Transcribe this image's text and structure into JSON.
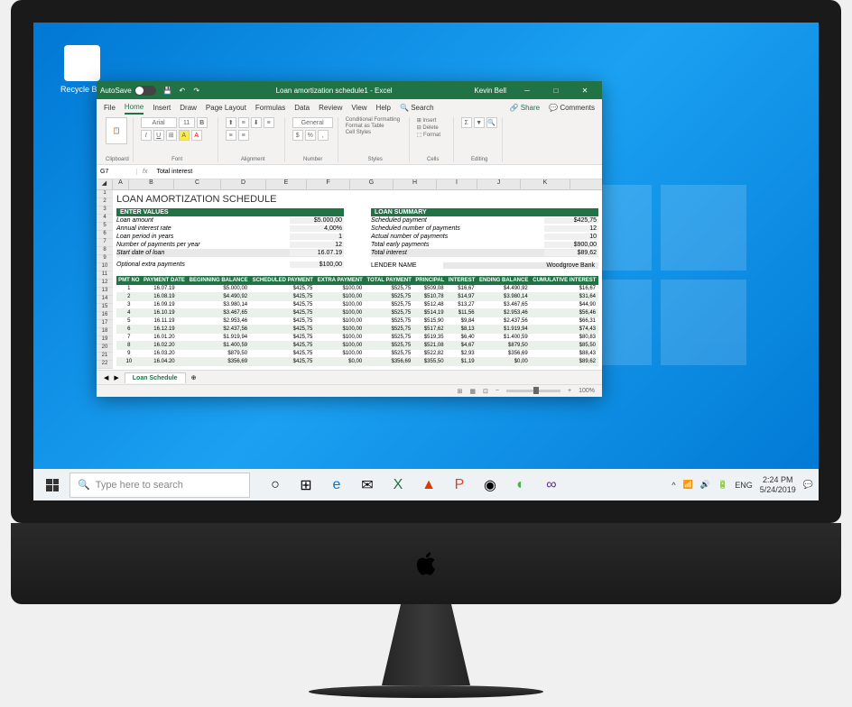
{
  "desktop": {
    "recycle_bin": "Recycle Bin"
  },
  "excel": {
    "autosave_label": "AutoSave",
    "title": "Loan amortization schedule1 - Excel",
    "user": "Kevin Bell",
    "tabs": {
      "file": "File",
      "home": "Home",
      "insert": "Insert",
      "draw": "Draw",
      "page_layout": "Page Layout",
      "formulas": "Formulas",
      "data": "Data",
      "review": "Review",
      "view": "View",
      "help": "Help",
      "search": "Search"
    },
    "share": "Share",
    "comments": "Comments",
    "ribbon": {
      "clipboard": "Clipboard",
      "paste": "Paste",
      "font_name": "Arial",
      "font_size": "11",
      "font": "Font",
      "alignment": "Alignment",
      "number_format": "General",
      "number": "Number",
      "cond_format": "Conditional Formatting",
      "format_table": "Format as Table",
      "cell_styles": "Cell Styles",
      "styles": "Styles",
      "insert_btn": "Insert",
      "delete_btn": "Delete",
      "format_btn": "Format",
      "cells": "Cells",
      "sort_filter": "Sort & Filter",
      "find_select": "Find & Select",
      "editing": "Editing"
    },
    "name_box": "G7",
    "formula": "Total interest",
    "columns": [
      "A",
      "B",
      "C",
      "D",
      "E",
      "F",
      "G",
      "H",
      "I",
      "J",
      "K"
    ],
    "doc": {
      "title": "LOAN AMORTIZATION SCHEDULE",
      "enter_values_header": "ENTER VALUES",
      "loan_summary_header": "LOAN SUMMARY",
      "enter_values": [
        {
          "label": "Loan amount",
          "value": "$5.000,00"
        },
        {
          "label": "Annual interest rate",
          "value": "4,00%"
        },
        {
          "label": "Loan period in years",
          "value": "1"
        },
        {
          "label": "Number of payments per year",
          "value": "12"
        },
        {
          "label": "Start date of loan",
          "value": "16.07.19"
        }
      ],
      "optional_extra": {
        "label": "Optional extra payments",
        "value": "$100,00"
      },
      "loan_summary": [
        {
          "label": "Scheduled payment",
          "value": "$425,75"
        },
        {
          "label": "Scheduled number of payments",
          "value": "12"
        },
        {
          "label": "Actual number of payments",
          "value": "10"
        },
        {
          "label": "Total early payments",
          "value": "$900,00"
        },
        {
          "label": "Total interest",
          "value": "$89,62"
        }
      ],
      "lender_label": "LENDER NAME",
      "lender_value": "Woodgrove Bank",
      "table_headers": [
        "PMT NO",
        "PAYMENT DATE",
        "BEGINNING BALANCE",
        "SCHEDULED PAYMENT",
        "EXTRA PAYMENT",
        "TOTAL PAYMENT",
        "PRINCIPAL",
        "INTEREST",
        "ENDING BALANCE",
        "CUMULATIVE INTEREST"
      ],
      "table_rows": [
        [
          "1",
          "16.07.19",
          "$5.000,00",
          "$425,75",
          "$100,00",
          "$525,75",
          "$509,08",
          "$16,67",
          "$4.490,92",
          "$16,67"
        ],
        [
          "2",
          "16.08.19",
          "$4.490,92",
          "$425,75",
          "$100,00",
          "$525,75",
          "$510,78",
          "$14,97",
          "$3.980,14",
          "$31,64"
        ],
        [
          "3",
          "16.09.19",
          "$3.980,14",
          "$425,75",
          "$100,00",
          "$525,75",
          "$512,48",
          "$13,27",
          "$3.467,65",
          "$44,90"
        ],
        [
          "4",
          "16.10.19",
          "$3.467,65",
          "$425,75",
          "$100,00",
          "$525,75",
          "$514,19",
          "$11,56",
          "$2.953,46",
          "$56,46"
        ],
        [
          "5",
          "16.11.19",
          "$2.953,46",
          "$425,75",
          "$100,00",
          "$525,75",
          "$515,90",
          "$9,84",
          "$2.437,56",
          "$66,31"
        ],
        [
          "6",
          "16.12.19",
          "$2.437,56",
          "$425,75",
          "$100,00",
          "$525,75",
          "$517,62",
          "$8,13",
          "$1.919,94",
          "$74,43"
        ],
        [
          "7",
          "16.01.20",
          "$1.919,94",
          "$425,75",
          "$100,00",
          "$525,75",
          "$519,35",
          "$6,40",
          "$1.400,59",
          "$80,83"
        ],
        [
          "8",
          "16.02.20",
          "$1.400,59",
          "$425,75",
          "$100,00",
          "$525,75",
          "$521,08",
          "$4,67",
          "$879,50",
          "$85,50"
        ],
        [
          "9",
          "16.03.20",
          "$879,50",
          "$425,75",
          "$100,00",
          "$525,75",
          "$522,82",
          "$2,93",
          "$356,69",
          "$88,43"
        ],
        [
          "10",
          "16.04.20",
          "$356,69",
          "$425,75",
          "$0,00",
          "$356,69",
          "$355,50",
          "$1,19",
          "$0,00",
          "$89,62"
        ]
      ]
    },
    "sheet_tab": "Loan Schedule",
    "zoom": "100%"
  },
  "taskbar": {
    "search_placeholder": "Type here to search",
    "lang": "ENG",
    "time": "2:24 PM",
    "date": "5/24/2019"
  }
}
